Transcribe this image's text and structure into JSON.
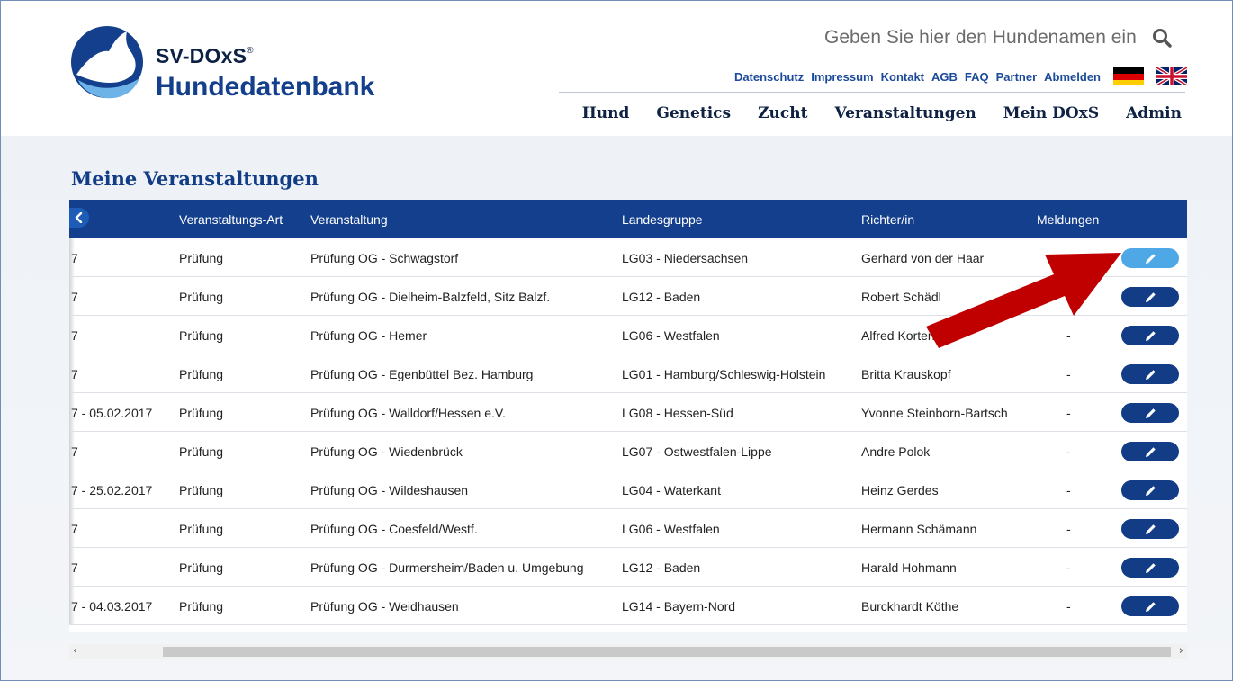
{
  "brand": {
    "line1": "SV-DOxS",
    "reg": "®",
    "line2": "Hundedatenbank"
  },
  "search": {
    "placeholder": "Geben Sie hier den Hundenamen ein"
  },
  "toplinks": [
    "Datenschutz",
    "Impressum",
    "Kontakt",
    "AGB",
    "FAQ",
    "Partner",
    "Abmelden"
  ],
  "mainnav": [
    "Hund",
    "Genetics",
    "Zucht",
    "Veranstaltungen",
    "Mein DOxS",
    "Admin"
  ],
  "page": {
    "title": "Meine Veranstaltungen"
  },
  "table": {
    "headers": [
      "Veranstaltungs-Art",
      "Veranstaltung",
      "Landesgruppe",
      "Richter/in",
      "Meldungen"
    ],
    "rows": [
      {
        "datum": "7",
        "art": "Prüfung",
        "veranstaltung": "Prüfung OG - Schwagstorf",
        "landesgruppe": "LG03 - Niedersachsen",
        "richter": "Gerhard von der Haar",
        "meldungen": ""
      },
      {
        "datum": "7",
        "art": "Prüfung",
        "veranstaltung": "Prüfung OG - Dielheim-Balzfeld, Sitz Balzf.",
        "landesgruppe": "LG12 - Baden",
        "richter": "Robert Schädl",
        "meldungen": ""
      },
      {
        "datum": "7",
        "art": "Prüfung",
        "veranstaltung": "Prüfung OG - Hemer",
        "landesgruppe": "LG06 - Westfalen",
        "richter": "Alfred Korten",
        "meldungen": "-"
      },
      {
        "datum": "7",
        "art": "Prüfung",
        "veranstaltung": "Prüfung OG - Egenbüttel Bez. Hamburg",
        "landesgruppe": "LG01 - Hamburg/Schleswig-Holstein",
        "richter": "Britta Krauskopf",
        "meldungen": "-"
      },
      {
        "datum": "7 - 05.02.2017",
        "art": "Prüfung",
        "veranstaltung": "Prüfung OG - Walldorf/Hessen e.V.",
        "landesgruppe": "LG08 - Hessen-Süd",
        "richter": "Yvonne Steinborn-Bartsch",
        "meldungen": "-"
      },
      {
        "datum": "7",
        "art": "Prüfung",
        "veranstaltung": "Prüfung OG - Wiedenbrück",
        "landesgruppe": "LG07 - Ostwestfalen-Lippe",
        "richter": "Andre Polok",
        "meldungen": "-"
      },
      {
        "datum": "7 - 25.02.2017",
        "art": "Prüfung",
        "veranstaltung": "Prüfung OG - Wildeshausen",
        "landesgruppe": "LG04 - Waterkant",
        "richter": "Heinz Gerdes",
        "meldungen": "-"
      },
      {
        "datum": "7",
        "art": "Prüfung",
        "veranstaltung": "Prüfung OG - Coesfeld/Westf.",
        "landesgruppe": "LG06 - Westfalen",
        "richter": "Hermann Schämann",
        "meldungen": "-"
      },
      {
        "datum": "7",
        "art": "Prüfung",
        "veranstaltung": "Prüfung OG - Durmersheim/Baden u. Umgebung",
        "landesgruppe": "LG12 - Baden",
        "richter": "Harald Hohmann",
        "meldungen": "-"
      },
      {
        "datum": "7 - 04.03.2017",
        "art": "Prüfung",
        "veranstaltung": "Prüfung OG - Weidhausen",
        "landesgruppe": "LG14 - Bayern-Nord",
        "richter": "Burckhardt Köthe",
        "meldungen": "-"
      }
    ]
  },
  "colors": {
    "primary": "#133f8c",
    "active_button": "#4fa8e6",
    "arrow": "#c00000"
  },
  "icons": {
    "search": "search-icon",
    "edit": "pencil-icon",
    "back": "chevron-left-icon"
  }
}
